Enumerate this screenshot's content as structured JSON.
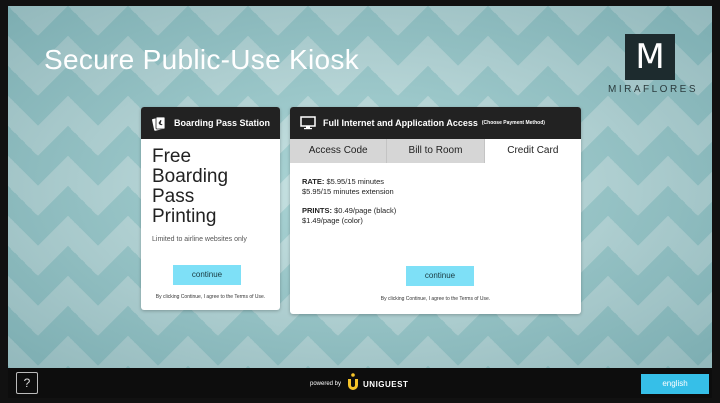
{
  "kiosk": {
    "title": "Secure Public-Use Kiosk",
    "logo_text": "MIRAFLORES",
    "logo_mark": "M"
  },
  "boarding": {
    "header": "Boarding Pass Station",
    "headline": [
      "Free",
      "Boarding",
      "Pass",
      "Printing"
    ],
    "limited": "Limited to airline websites only",
    "button": "continue",
    "terms": "By clicking Continue, I agree to the Terms of Use."
  },
  "internet": {
    "header": "Full Internet and Application Access",
    "header_note": "(Choose Payment Method)",
    "tabs": [
      {
        "label": "Access Code",
        "active": false
      },
      {
        "label": "Bill to Room",
        "active": false
      },
      {
        "label": "Credit Card",
        "active": true
      }
    ],
    "rate_label": "RATE:",
    "rate_value": "$5.95/15 minutes",
    "rate_extension": "$5.95/15 minutes extension",
    "prints_label": "PRINTS:",
    "prints_value": "$0.49/page (black)",
    "prints_color": "$1.49/page (color)",
    "button": "continue",
    "terms": "By clicking Continue, I agree to the Terms of Use."
  },
  "footer": {
    "help": "?",
    "powered_by": "powered by",
    "brand": "UNIGUEST",
    "language": "english"
  },
  "colors": {
    "accent": "#36bfe8",
    "continue_button": "#7ee0f7",
    "brand_yellow": "#f7c52a"
  }
}
